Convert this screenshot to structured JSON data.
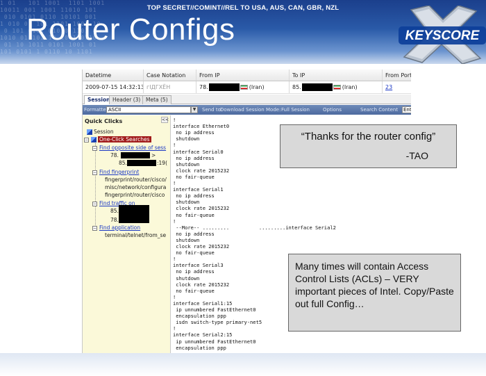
{
  "slide": {
    "classification": "TOP SECRET//COMINT//REL TO USA, AUS, CAN, GBR, NZL",
    "title": "Router Configs",
    "logo_text": "KEYSCORE"
  },
  "grid": {
    "columns": [
      "Datetime",
      "Case Notation",
      "From IP",
      "To IP",
      "From Port"
    ],
    "row": {
      "datetime": "2009-07-15 14:32:13",
      "case_notation": "гІДГХЁН",
      "from_ip_prefix": "78.",
      "from_country": "Iran",
      "to_ip_prefix": "85.",
      "to_country": "Iran",
      "from_port": "23"
    }
  },
  "tabs": [
    "Session",
    "Header (3)",
    "Meta (5)"
  ],
  "toolbar": {
    "formatter_label": "Formatter",
    "formatter_value": "ASCII",
    "send_to": "Send to:",
    "download": "Download Session",
    "mode": "Mode:",
    "mode_value": "Full Session",
    "options": "Options",
    "search": "Search Content",
    "search_value": "Ente"
  },
  "quick_clicks": {
    "title": "Quick Clicks",
    "collapse": "<<",
    "session": "Session",
    "one_click": "One-Click Searches",
    "opposite_side": "Find opposite side of sess",
    "opp_line1": "78.",
    "opp_line1_suffix": ">",
    "opp_line2": "85.",
    "opp_line2_suffix": ":19(",
    "find_fingerprint": "Find fingerprint",
    "fp1": "fingerprint/router/cisco/",
    "fp2": "misc/network/configura",
    "fp3": "fingerprint/router/cisco",
    "find_traffic": "Find traffic on",
    "traffic1": "85.",
    "traffic2": "78.",
    "find_application": "Find application",
    "app1": "terminal/telnet/from_se"
  },
  "config_lines": [
    "!",
    "interface Ethernet0",
    " no ip address",
    " shutdown",
    "!",
    "interface Serial0",
    " no ip address",
    " shutdown",
    " clock rate 2015232",
    " no fair-queue",
    "!",
    "interface Serial1",
    " no ip address",
    " shutdown",
    " clock rate 2015232",
    " no fair-queue",
    "!",
    " --More-- .........          .........interface Serial2",
    " no ip address",
    " shutdown",
    " clock rate 2015232",
    " no fair-queue",
    "!",
    "interface Serial3",
    " no ip address",
    " shutdown",
    " clock rate 2015232",
    " no fair-queue",
    "!",
    "interface Serial1:15",
    " ip unnumbered FastEthernet0",
    " encapsulation ppp",
    " isdn switch-type primary-net5",
    "!",
    "interface Serial2:15",
    " ip unnumbered FastEthernet0",
    " encapsulation ppp"
  ],
  "callouts": {
    "tao_quote": "“Thanks for the router config”",
    "tao_sign": "-TAO",
    "acl_note": "Many times will contain Access Control Lists (ACLs) – VERY important pieces of Intel. Copy/Paste out full Config…"
  }
}
